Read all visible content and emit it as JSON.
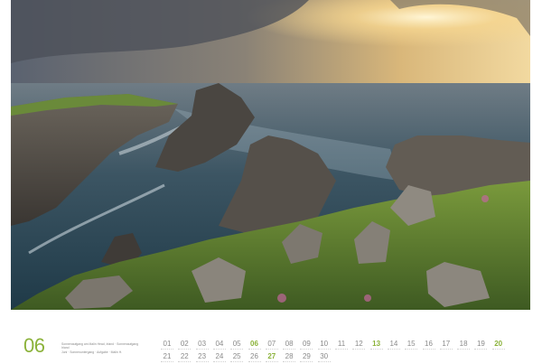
{
  "calendar": {
    "month_number": "06",
    "caption": [
      "Sonnenaufgang am Malin Head, Irland · Sonnenaufgang",
      "Irland",
      "Juni · Sonnenuntergang · Aufgabe · Malin H."
    ],
    "accent_color": "#8bb23a",
    "week1": [
      {
        "day": "01",
        "sunday": false
      },
      {
        "day": "02",
        "sunday": false
      },
      {
        "day": "03",
        "sunday": false
      },
      {
        "day": "04",
        "sunday": false
      },
      {
        "day": "05",
        "sunday": false
      },
      {
        "day": "06",
        "sunday": true
      },
      {
        "day": "07",
        "sunday": false
      },
      {
        "day": "08",
        "sunday": false
      },
      {
        "day": "09",
        "sunday": false
      },
      {
        "day": "10",
        "sunday": false
      },
      {
        "day": "11",
        "sunday": false
      },
      {
        "day": "12",
        "sunday": false
      },
      {
        "day": "13",
        "sunday": true
      },
      {
        "day": "14",
        "sunday": false
      },
      {
        "day": "15",
        "sunday": false
      },
      {
        "day": "16",
        "sunday": false
      },
      {
        "day": "17",
        "sunday": false
      },
      {
        "day": "18",
        "sunday": false
      },
      {
        "day": "19",
        "sunday": false
      },
      {
        "day": "20",
        "sunday": true
      }
    ],
    "week2": [
      {
        "day": "21",
        "sunday": false
      },
      {
        "day": "22",
        "sunday": false
      },
      {
        "day": "23",
        "sunday": false
      },
      {
        "day": "24",
        "sunday": false
      },
      {
        "day": "25",
        "sunday": false
      },
      {
        "day": "26",
        "sunday": false
      },
      {
        "day": "27",
        "sunday": true
      },
      {
        "day": "28",
        "sunday": false
      },
      {
        "day": "29",
        "sunday": false
      },
      {
        "day": "30",
        "sunday": false
      }
    ]
  }
}
